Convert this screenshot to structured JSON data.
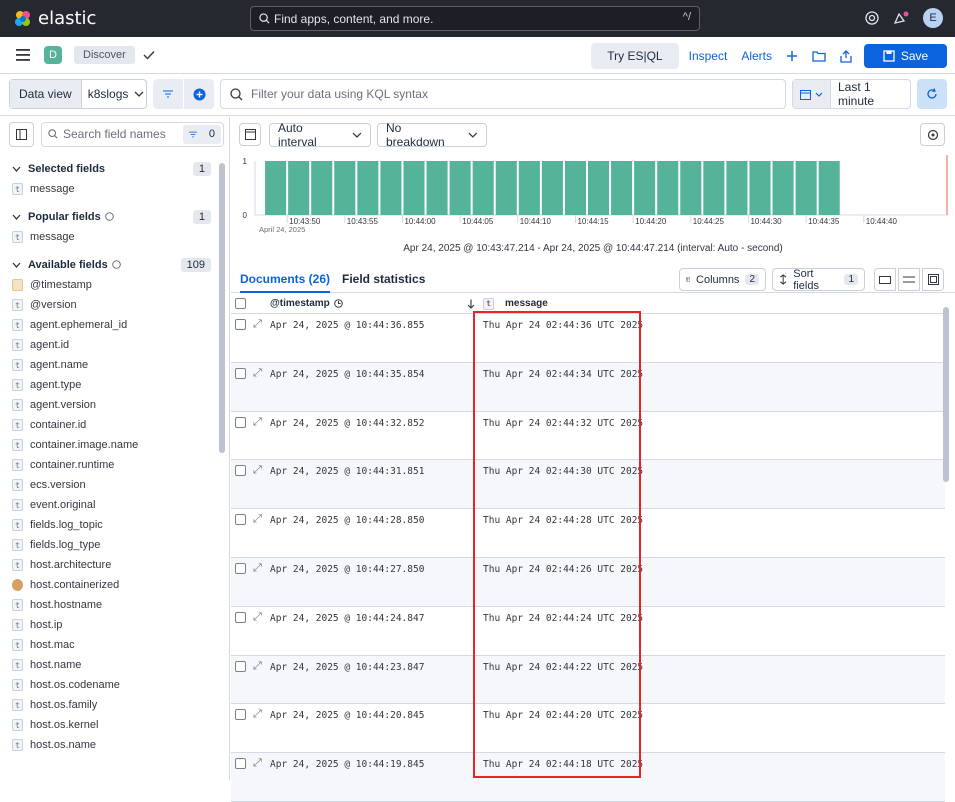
{
  "topbar": {
    "logo_text": "elastic",
    "search_placeholder": "Find apps, content, and more.",
    "search_shortcut": "^/",
    "avatar_initial": "E"
  },
  "appbar": {
    "space_initial": "D",
    "breadcrumb": "Discover",
    "try_esql": "Try ES|QL",
    "inspect": "Inspect",
    "alerts": "Alerts",
    "save": "Save"
  },
  "querybar": {
    "data_view_label": "Data view",
    "data_view_value": "k8slogs",
    "kql_placeholder": "Filter your data using KQL syntax",
    "time_range": "Last 1 minute"
  },
  "sidebar": {
    "search_placeholder": "Search field names",
    "filter_count": "0",
    "selected": {
      "title": "Selected fields",
      "count": "1",
      "fields": [
        {
          "type": "t",
          "name": "message"
        }
      ]
    },
    "popular": {
      "title": "Popular fields",
      "count": "1",
      "fields": [
        {
          "type": "t",
          "name": "message"
        }
      ]
    },
    "available": {
      "title": "Available fields",
      "count": "109",
      "fields": [
        {
          "type": "date",
          "name": "@timestamp"
        },
        {
          "type": "t",
          "name": "@version"
        },
        {
          "type": "t",
          "name": "agent.ephemeral_id"
        },
        {
          "type": "t",
          "name": "agent.id"
        },
        {
          "type": "t",
          "name": "agent.name"
        },
        {
          "type": "t",
          "name": "agent.type"
        },
        {
          "type": "t",
          "name": "agent.version"
        },
        {
          "type": "t",
          "name": "container.id"
        },
        {
          "type": "t",
          "name": "container.image.name"
        },
        {
          "type": "t",
          "name": "container.runtime"
        },
        {
          "type": "t",
          "name": "ecs.version"
        },
        {
          "type": "t",
          "name": "event.original"
        },
        {
          "type": "t",
          "name": "fields.log_topic"
        },
        {
          "type": "t",
          "name": "fields.log_type"
        },
        {
          "type": "t",
          "name": "host.architecture"
        },
        {
          "type": "bool",
          "name": "host.containerized"
        },
        {
          "type": "t",
          "name": "host.hostname"
        },
        {
          "type": "t",
          "name": "host.ip"
        },
        {
          "type": "t",
          "name": "host.mac"
        },
        {
          "type": "t",
          "name": "host.name"
        },
        {
          "type": "t",
          "name": "host.os.codename"
        },
        {
          "type": "t",
          "name": "host.os.family"
        },
        {
          "type": "t",
          "name": "host.os.kernel"
        },
        {
          "type": "t",
          "name": "host.os.name"
        }
      ]
    }
  },
  "histogram": {
    "interval": "Auto interval",
    "breakdown": "No breakdown",
    "caption": "Apr 24, 2025 @ 10:43:47.214 - Apr 24, 2025 @ 10:44:47.214 (interval: Auto - second)",
    "date_label": "April 24, 2025",
    "y_ticks": [
      "1",
      "0"
    ],
    "x_ticks": [
      "10:43:50",
      "10:43:55",
      "10:44:00",
      "10:44:05",
      "10:44:10",
      "10:44:15",
      "10:44:20",
      "10:44:25",
      "10:44:30",
      "10:44:35",
      "10:44:40"
    ],
    "bar_color": "#54b399"
  },
  "chart_data": {
    "type": "bar",
    "x": [
      "10:43:48",
      "10:43:50",
      "10:43:52",
      "10:43:54",
      "10:43:56",
      "10:43:58",
      "10:44:00",
      "10:44:02",
      "10:44:04",
      "10:44:06",
      "10:44:08",
      "10:44:10",
      "10:44:12",
      "10:44:14",
      "10:44:16",
      "10:44:18",
      "10:44:20",
      "10:44:22",
      "10:44:24",
      "10:44:26",
      "10:44:28",
      "10:44:30",
      "10:44:32",
      "10:44:34",
      "10:44:36"
    ],
    "values": [
      1,
      1,
      1,
      1,
      1,
      1,
      1,
      1,
      1,
      1,
      1,
      1,
      1,
      1,
      1,
      1,
      1,
      1,
      1,
      1,
      1,
      1,
      1,
      1,
      1
    ],
    "ylim": [
      0,
      1
    ]
  },
  "grid": {
    "tab_documents": "Documents (26)",
    "tab_field_stats": "Field statistics",
    "columns_label": "Columns",
    "columns_count": "2",
    "sort_label": "Sort fields",
    "sort_count": "1",
    "col_timestamp": "@timestamp",
    "col_message": "message",
    "rows": [
      {
        "ts": "Apr 24, 2025 @ 10:44:36.855",
        "msg": "Thu Apr 24 02:44:36 UTC 2025"
      },
      {
        "ts": "Apr 24, 2025 @ 10:44:35.854",
        "msg": "Thu Apr 24 02:44:34 UTC 2025"
      },
      {
        "ts": "Apr 24, 2025 @ 10:44:32.852",
        "msg": "Thu Apr 24 02:44:32 UTC 2025"
      },
      {
        "ts": "Apr 24, 2025 @ 10:44:31.851",
        "msg": "Thu Apr 24 02:44:30 UTC 2025"
      },
      {
        "ts": "Apr 24, 2025 @ 10:44:28.850",
        "msg": "Thu Apr 24 02:44:28 UTC 2025"
      },
      {
        "ts": "Apr 24, 2025 @ 10:44:27.850",
        "msg": "Thu Apr 24 02:44:26 UTC 2025"
      },
      {
        "ts": "Apr 24, 2025 @ 10:44:24.847",
        "msg": "Thu Apr 24 02:44:24 UTC 2025"
      },
      {
        "ts": "Apr 24, 2025 @ 10:44:23.847",
        "msg": "Thu Apr 24 02:44:22 UTC 2025"
      },
      {
        "ts": "Apr 24, 2025 @ 10:44:20.845",
        "msg": "Thu Apr 24 02:44:20 UTC 2025"
      },
      {
        "ts": "Apr 24, 2025 @ 10:44:19.845",
        "msg": "Thu Apr 24 02:44:18 UTC 2025"
      }
    ]
  },
  "colors": {
    "accent": "#0b64dd",
    "highlight": "#e5252a"
  }
}
